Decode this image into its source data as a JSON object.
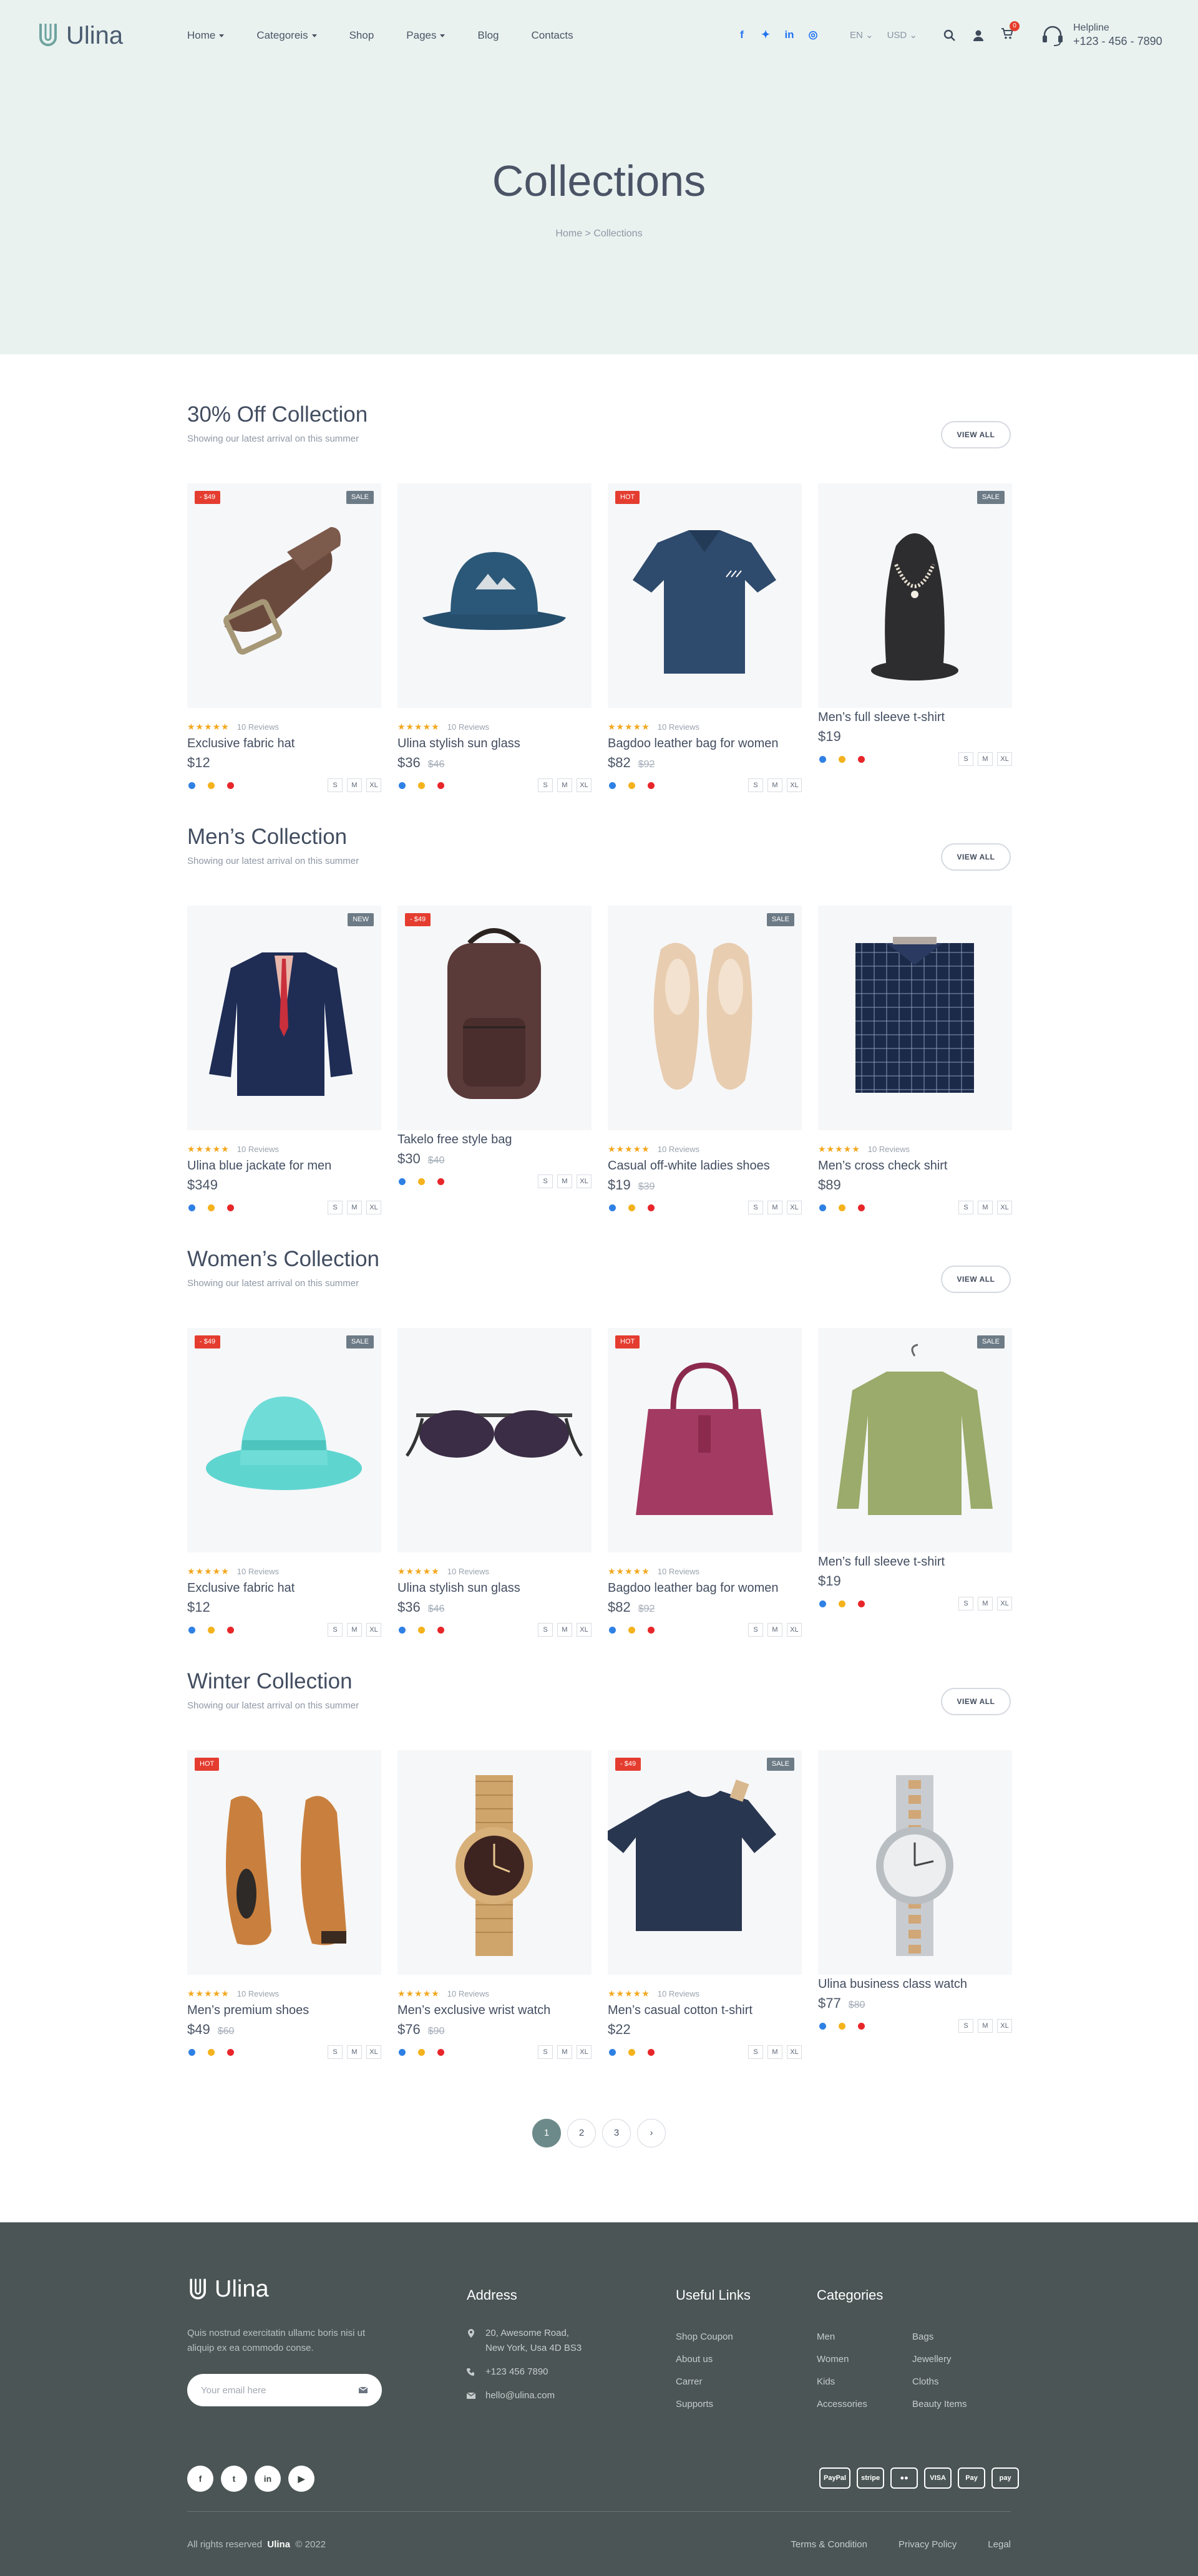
{
  "brand": {
    "name": "Ulina"
  },
  "nav": {
    "items": [
      {
        "label": "Home",
        "dropdown": true
      },
      {
        "label": "Categoreis",
        "dropdown": true
      },
      {
        "label": "Shop",
        "dropdown": false
      },
      {
        "label": "Pages",
        "dropdown": true
      },
      {
        "label": "Blog",
        "dropdown": false
      },
      {
        "label": "Contacts",
        "dropdown": false
      }
    ]
  },
  "header": {
    "social_icons": [
      "facebook-icon",
      "twitter-icon",
      "linkedin-icon",
      "instagram-icon"
    ],
    "language": "EN",
    "currency": "USD",
    "cart_count": "0",
    "helpline_label": "Helpline",
    "helpline_number": "+123 - 456 - 7890"
  },
  "hero": {
    "title": "Collections",
    "breadcrumb": "Home  >  Collections"
  },
  "view_all_label": "VIEW ALL",
  "subtitle": "Showing our latest arrival on this summer",
  "reviews_label": "10 Reviews",
  "sizes": [
    "S",
    "M",
    "XL"
  ],
  "colors": {
    "blue": "#2f80e4",
    "yellow": "#f4b21d",
    "red": "#e8262a",
    "accent": "#6d8a8a",
    "footer_bg": "#4b5555"
  },
  "sections": [
    {
      "title": "30% Off Collection",
      "products": [
        {
          "name": "Exclusive fabric hat",
          "price": "$12",
          "old_price": "",
          "rating": true,
          "badge_left": "- $49",
          "badge_right": "SALE",
          "image": "belt"
        },
        {
          "name": "Ulina stylish sun glass",
          "price": "$36",
          "old_price": "$46",
          "rating": true,
          "badge_left": "",
          "badge_right": "",
          "image": "bucket-hat"
        },
        {
          "name": "Bagdoo leather bag for women",
          "price": "$82",
          "old_price": "$92",
          "rating": true,
          "badge_left": "HOT",
          "badge_right": "",
          "image": "polo"
        },
        {
          "name": "Men’s full sleeve t-shirt",
          "price": "$19",
          "old_price": "",
          "rating": false,
          "badge_left": "",
          "badge_right": "SALE",
          "image": "necklace"
        }
      ]
    },
    {
      "title": "Men’s Collection",
      "products": [
        {
          "name": "Ulina blue jackate for men",
          "price": "$349",
          "old_price": "",
          "rating": true,
          "badge_left": "",
          "badge_right": "NEW",
          "image": "blazer"
        },
        {
          "name": "Takelo free style bag",
          "price": "$30",
          "old_price": "$40",
          "rating": false,
          "badge_left": "- $49",
          "badge_right": "",
          "image": "backpack"
        },
        {
          "name": "Casual off-white ladies shoes",
          "price": "$19",
          "old_price": "$39",
          "rating": true,
          "badge_left": "",
          "badge_right": "SALE",
          "image": "flats"
        },
        {
          "name": "Men’s cross check shirt",
          "price": "$89",
          "old_price": "",
          "rating": true,
          "badge_left": "",
          "badge_right": "",
          "image": "shirt"
        }
      ]
    },
    {
      "title": "Women’s Collection",
      "products": [
        {
          "name": "Exclusive fabric hat",
          "price": "$12",
          "old_price": "",
          "rating": true,
          "badge_left": "- $49",
          "badge_right": "SALE",
          "image": "fedora"
        },
        {
          "name": "Ulina stylish sun glass",
          "price": "$36",
          "old_price": "$46",
          "rating": true,
          "badge_left": "",
          "badge_right": "",
          "image": "sunglasses"
        },
        {
          "name": "Bagdoo leather bag for women",
          "price": "$82",
          "old_price": "$92",
          "rating": true,
          "badge_left": "HOT",
          "badge_right": "",
          "image": "handbag"
        },
        {
          "name": "Men’s full sleeve t-shirt",
          "price": "$19",
          "old_price": "",
          "rating": false,
          "badge_left": "",
          "badge_right": "SALE",
          "image": "sweater"
        }
      ]
    },
    {
      "title": "Winter Collection",
      "products": [
        {
          "name": "Men’s premium shoes",
          "price": "$49",
          "old_price": "$60",
          "rating": true,
          "badge_left": "HOT",
          "badge_right": "",
          "image": "shoes"
        },
        {
          "name": "Men’s exclusive wrist watch",
          "price": "$76",
          "old_price": "$90",
          "rating": true,
          "badge_left": "",
          "badge_right": "",
          "image": "gold-watch"
        },
        {
          "name": "Men’s casual cotton t-shirt",
          "price": "$22",
          "old_price": "",
          "rating": true,
          "badge_left": "- $49",
          "badge_right": "SALE",
          "image": "tshirt"
        },
        {
          "name": "Ulina business class watch",
          "price": "$77",
          "old_price": "$80",
          "rating": false,
          "badge_left": "",
          "badge_right": "",
          "image": "silver-watch"
        }
      ]
    }
  ],
  "pagination": [
    "1",
    "2",
    "3",
    "›"
  ],
  "footer": {
    "description": "Quis nostrud exercitatin ullamc boris nisi ut aliquip ex ea commodo conse.",
    "email_placeholder": "Your email here",
    "address_title": "Address",
    "address_line1": "20, Awesome Road,",
    "address_line2": "New York, Usa 4D BS3",
    "phone": "+123 456 7890",
    "email": "hello@ulina.com",
    "useful_title": "Useful Links",
    "useful_links": [
      "Shop Coupon",
      "About us",
      "Carrer",
      "Supports"
    ],
    "categories_title": "Categories",
    "categories_col1": [
      "Men",
      "Women",
      "Kids",
      "Accessories"
    ],
    "categories_col2": [
      "Bags",
      "Jewellery",
      "Cloths",
      "Beauty Items"
    ],
    "social": [
      "f",
      "t",
      "in",
      "▶"
    ],
    "payments": [
      "PayPal",
      "stripe",
      "●●",
      "VISA",
      "Pay",
      "pay"
    ],
    "copyright_prefix": "All rights reserved",
    "copyright_brand": "Ulina",
    "copyright_year": "©  2022",
    "legal_links": [
      "Terms & Condition",
      "Privacy Policy",
      "Legal"
    ]
  }
}
